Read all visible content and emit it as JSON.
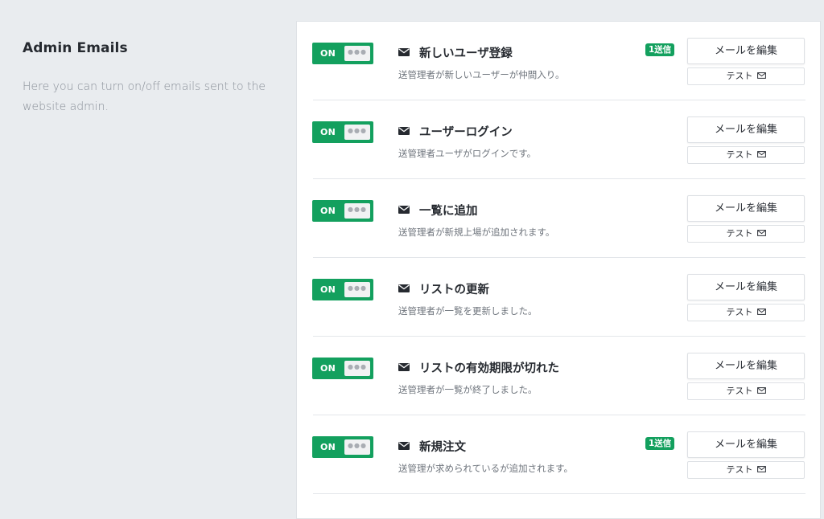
{
  "intro": {
    "title": "Admin Emails",
    "description": "Here you can turn on/off emails sent to the website admin."
  },
  "icons": {
    "envelope": "envelope-icon",
    "envelope_outline": "envelope-outline-icon"
  },
  "colors": {
    "toggle_on": "#13a05e",
    "badge": "#13a05e",
    "background": "#e9ecef",
    "panel": "#ffffff"
  },
  "emails": [
    {
      "toggle": "ON",
      "title": "新しいユーザ登録",
      "description": "送管理者が新しいユーザーが仲間入り。",
      "badge": "1送信",
      "edit_label": "メールを編集",
      "test_label": "テスト"
    },
    {
      "toggle": "ON",
      "title": "ユーザーログイン",
      "description": "送管理者ユーザがログインです。",
      "edit_label": "メールを編集",
      "test_label": "テスト"
    },
    {
      "toggle": "ON",
      "title": "一覧に追加",
      "description": "送管理者が新規上場が追加されます。",
      "edit_label": "メールを編集",
      "test_label": "テスト"
    },
    {
      "toggle": "ON",
      "title": "リストの更新",
      "description": "送管理者が一覧を更新しました。",
      "edit_label": "メールを編集",
      "test_label": "テスト"
    },
    {
      "toggle": "ON",
      "title": "リストの有効期限が切れた",
      "description": "送管理者が一覧が終了しました。",
      "edit_label": "メールを編集",
      "test_label": "テスト"
    },
    {
      "toggle": "ON",
      "title": "新規注文",
      "description": "送管理が求められているが追加されます。",
      "badge": "1送信",
      "edit_label": "メールを編集",
      "test_label": "テスト"
    }
  ]
}
